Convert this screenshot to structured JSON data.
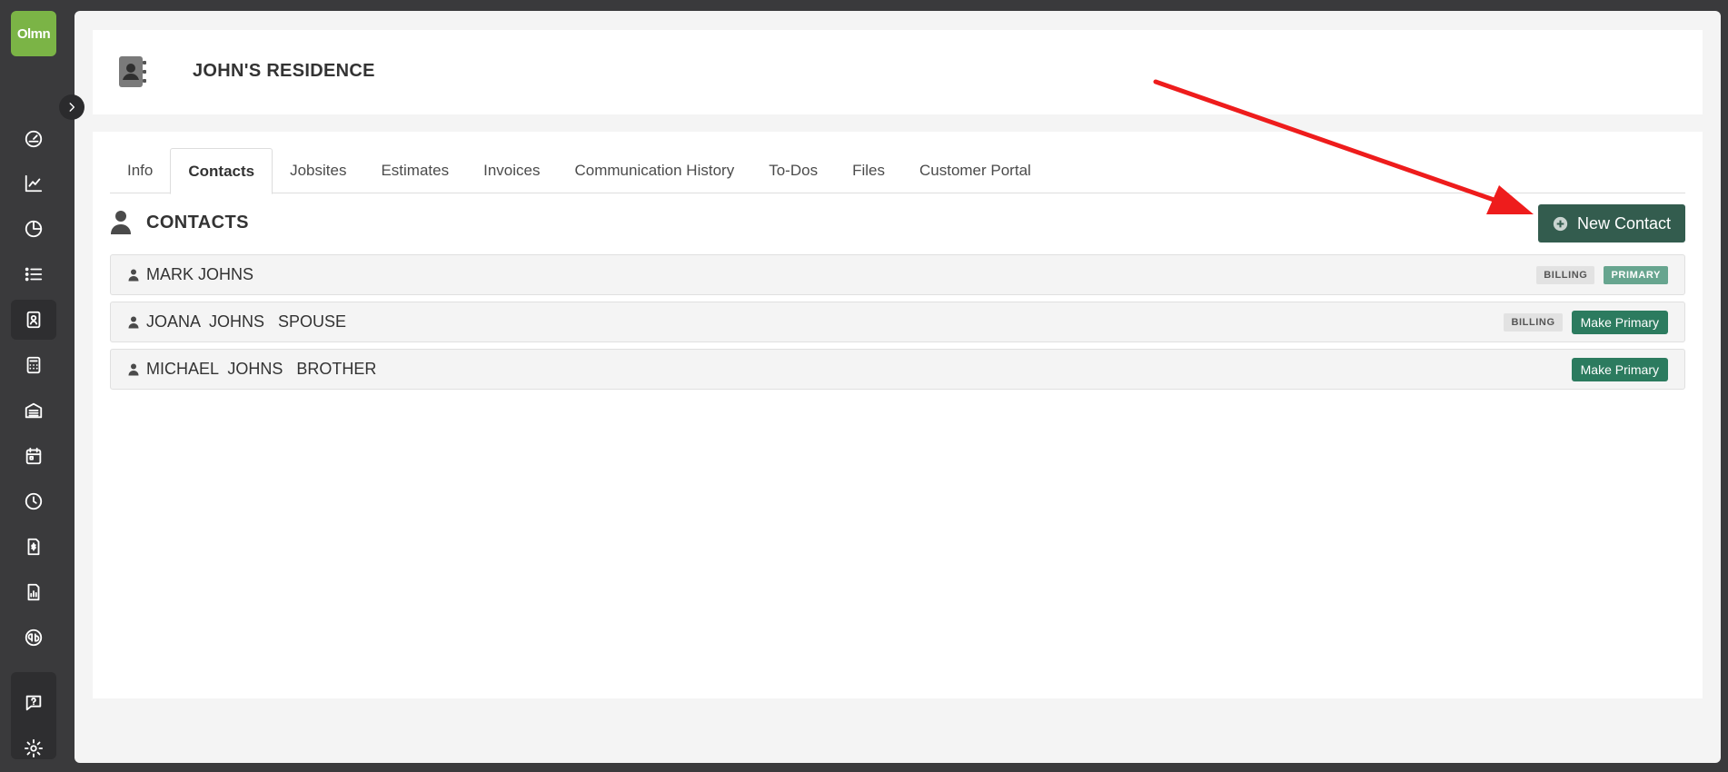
{
  "app": {
    "logo_text": "Olmn"
  },
  "header": {
    "title": "JOHN'S RESIDENCE"
  },
  "tabs": [
    {
      "label": "Info"
    },
    {
      "label": "Contacts",
      "active": true
    },
    {
      "label": "Jobsites"
    },
    {
      "label": "Estimates"
    },
    {
      "label": "Invoices"
    },
    {
      "label": "Communication History"
    },
    {
      "label": "To-Dos"
    },
    {
      "label": "Files"
    },
    {
      "label": "Customer Portal"
    }
  ],
  "contacts_section": {
    "title": "CONTACTS",
    "new_button_label": "New Contact",
    "rows": [
      {
        "name": "MARK JOHNS",
        "badge_billing": "BILLING",
        "badge_primary": "PRIMARY",
        "action": ""
      },
      {
        "name": "JOANA  JOHNS   SPOUSE",
        "badge_billing": "BILLING",
        "badge_primary": "",
        "action": "Make Primary"
      },
      {
        "name": "MICHAEL  JOHNS   BROTHER",
        "badge_billing": "",
        "badge_primary": "",
        "action": "Make Primary"
      }
    ]
  },
  "sidebar": {
    "icons": [
      "dashboard-icon",
      "line-chart-icon",
      "pie-chart-icon",
      "list-icon",
      "contacts-book-icon",
      "calculator-icon",
      "warehouse-icon",
      "calendar-icon",
      "clock-icon",
      "invoice-icon",
      "report-icon",
      "quickbooks-icon",
      "help-chat-icon",
      "settings-icon"
    ]
  },
  "colors": {
    "sidebar_bg": "#3a3a3c",
    "brand_green": "#7bb446",
    "new_button": "#335c4e",
    "make_primary": "#2c7b5f",
    "primary_badge": "#67a58f",
    "annotation_arrow": "#ee1c1c"
  }
}
